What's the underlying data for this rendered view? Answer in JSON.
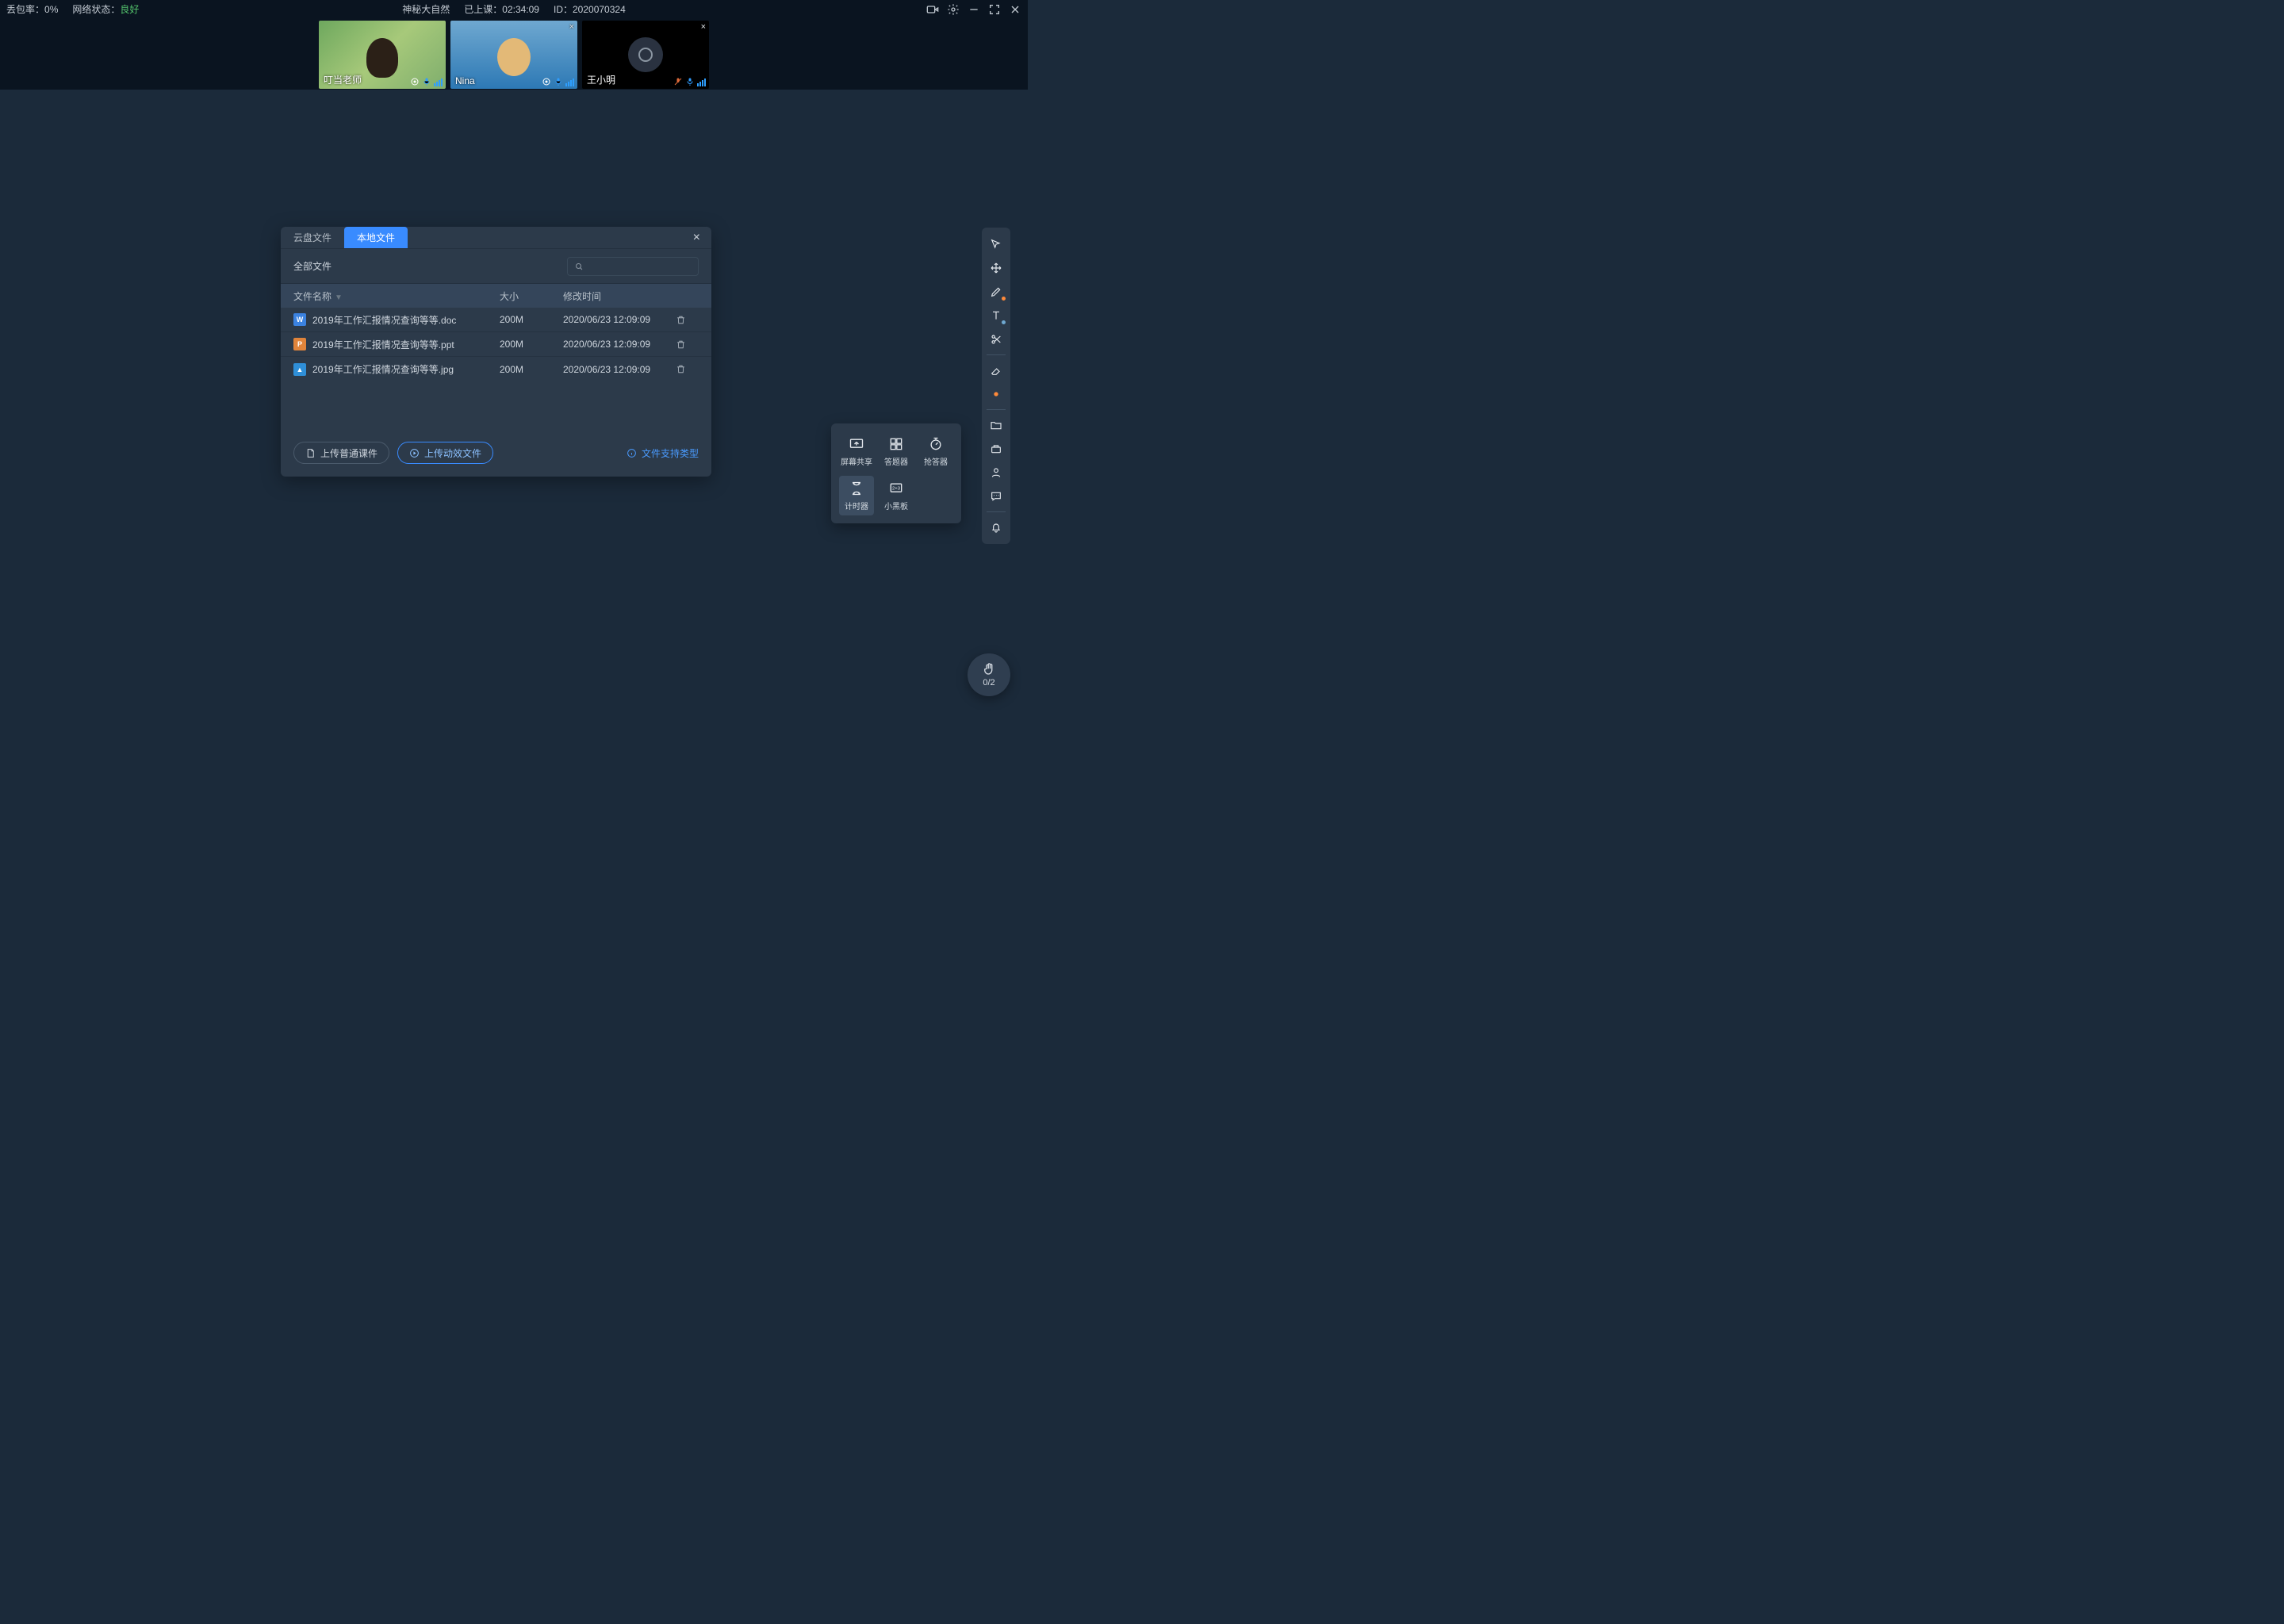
{
  "topbar": {
    "packet_loss_label": "丢包率：",
    "packet_loss_value": "0%",
    "network_label": "网络状态：",
    "network_value": "良好",
    "course_title": "神秘大自然",
    "elapsed_label": "已上课：",
    "elapsed_value": "02:34:09",
    "id_label": "ID：",
    "id_value": "2020070324"
  },
  "participants": [
    {
      "name": "叮当老师",
      "mic": "on",
      "mic_muted": false,
      "no_cam": false,
      "thumb": "camA"
    },
    {
      "name": "Nina",
      "mic": "on",
      "mic_muted": false,
      "no_cam": false,
      "thumb": "camB"
    },
    {
      "name": "王小明",
      "mic": "on",
      "mic_muted": true,
      "no_cam": true,
      "thumb": "camC"
    }
  ],
  "file_dialog": {
    "tab_cloud": "云盘文件",
    "tab_local": "本地文件",
    "all_files": "全部文件",
    "col_name": "文件名称",
    "col_size": "大小",
    "col_date": "修改时间",
    "upload_normal": "上传普通课件",
    "upload_anim": "上传动效文件",
    "supported_hint": "文件支持类型",
    "rows": [
      {
        "icon": "doc",
        "icon_letter": "W",
        "name": "2019年工作汇报情况查询等等.doc",
        "size": "200M",
        "date": "2020/06/23 12:09:09"
      },
      {
        "icon": "ppt",
        "icon_letter": "P",
        "name": "2019年工作汇报情况查询等等.ppt",
        "size": "200M",
        "date": "2020/06/23 12:09:09"
      },
      {
        "icon": "img",
        "icon_letter": "▲",
        "name": "2019年工作汇报情况查询等等.jpg",
        "size": "200M",
        "date": "2020/06/23 12:09:09"
      }
    ]
  },
  "tool_popover": {
    "items": [
      {
        "key": "screen_share",
        "label": "屏幕共享"
      },
      {
        "key": "answerer",
        "label": "答题器"
      },
      {
        "key": "responder",
        "label": "抢答器"
      },
      {
        "key": "timer",
        "label": "计时器"
      },
      {
        "key": "blackboard",
        "label": "小黑板"
      }
    ],
    "selected": "timer"
  },
  "vtoolbar": {
    "items": [
      "laser-pointer",
      "move",
      "pen",
      "text",
      "scissors",
      "eraser",
      "color-picker",
      "_sep",
      "folder",
      "toolbox",
      "user",
      "chat",
      "_sep",
      "bell"
    ],
    "pen_has_dot": true,
    "text_has_dot": true
  },
  "hand_raise": {
    "count": "0/2"
  }
}
